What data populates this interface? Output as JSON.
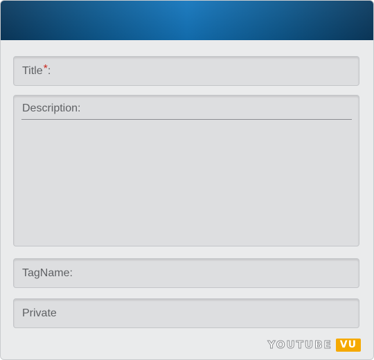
{
  "form": {
    "title_label": "Title",
    "title_required_mark": "*",
    "title_colon": ":",
    "description_label": "Description:",
    "tagname_label": "TagName:",
    "private_label": "Private"
  },
  "branding": {
    "logo_text": "YOUTUBE",
    "logo_badge": "VU",
    "header_color": "#1476bd",
    "badge_color": "#f5a900",
    "required_color": "#c8281e"
  }
}
